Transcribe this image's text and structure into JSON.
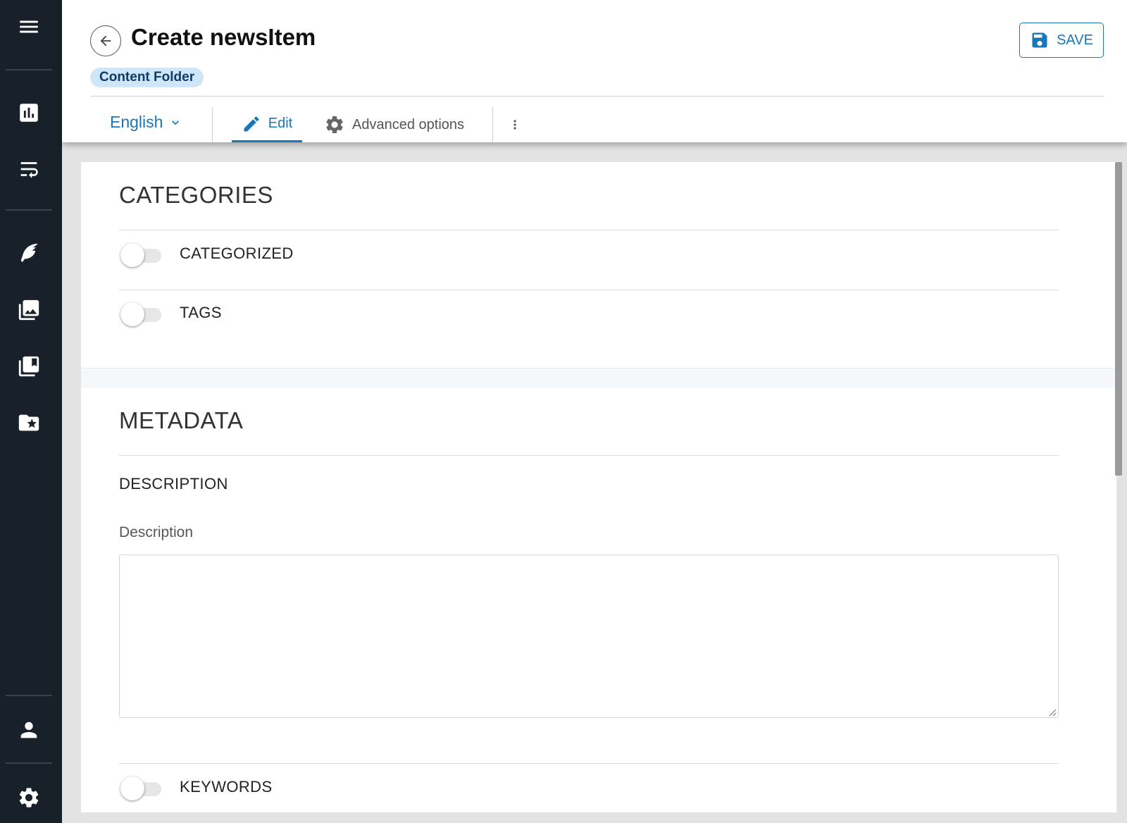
{
  "header": {
    "title": "Create newsItem",
    "badge": "Content Folder",
    "save_label": "SAVE",
    "language": "English",
    "tabs": [
      {
        "label": "Edit",
        "icon": "pencil-icon",
        "active": true
      },
      {
        "label": "Advanced options",
        "icon": "gear-icon",
        "active": false
      }
    ]
  },
  "sidebar": {
    "items": [
      {
        "name": "menu",
        "icon": "hamburger-icon"
      },
      {
        "name": "analytics",
        "icon": "bar-chart-icon"
      },
      {
        "name": "workflow",
        "icon": "wrap-text-icon"
      },
      {
        "name": "content",
        "icon": "feather-icon"
      },
      {
        "name": "media",
        "icon": "image-library-icon"
      },
      {
        "name": "collections",
        "icon": "bookmark-library-icon"
      },
      {
        "name": "favorites",
        "icon": "star-folder-icon"
      },
      {
        "name": "account",
        "icon": "person-icon"
      },
      {
        "name": "settings",
        "icon": "gear-icon"
      }
    ]
  },
  "categories": {
    "title": "CATEGORIES",
    "toggles": [
      {
        "label": "CATEGORIZED",
        "on": false
      },
      {
        "label": "TAGS",
        "on": false
      }
    ]
  },
  "metadata": {
    "title": "METADATA",
    "description_heading": "DESCRIPTION",
    "description_label": "Description",
    "description_value": "",
    "keywords_label": "KEYWORDS",
    "keywords_on": false
  },
  "colors": {
    "sidebar_bg": "#18202a",
    "accent": "#1976b8",
    "badge_bg": "#cfe6f8"
  }
}
